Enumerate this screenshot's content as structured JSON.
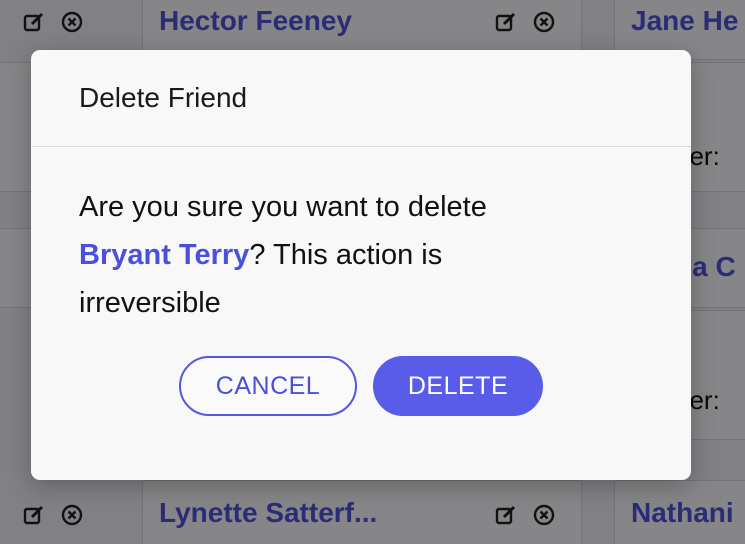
{
  "background_cards": [
    {
      "name": "Hector Feeney"
    },
    {
      "name": "Jane He"
    },
    {
      "name": "na C"
    },
    {
      "name": "Lynette Satterf..."
    },
    {
      "name": "Nathani"
    }
  ],
  "background_fields": {
    "field_a": ":",
    "field_b": "der:",
    "field_c": ":",
    "field_d": "der:"
  },
  "modal": {
    "title": "Delete Friend",
    "message_prefix": "Are you sure you want to delete",
    "friend_name": "Bryant Terry",
    "message_suffix": "? This action is irreversible",
    "cancel_label": "CANCEL",
    "delete_label": "DELETE"
  },
  "colors": {
    "accent": "#585ce8",
    "link": "#4a4fdc",
    "overlay": "rgba(0,0,0,0.45)"
  },
  "icons": [
    "edit-icon",
    "remove-circle-icon"
  ]
}
